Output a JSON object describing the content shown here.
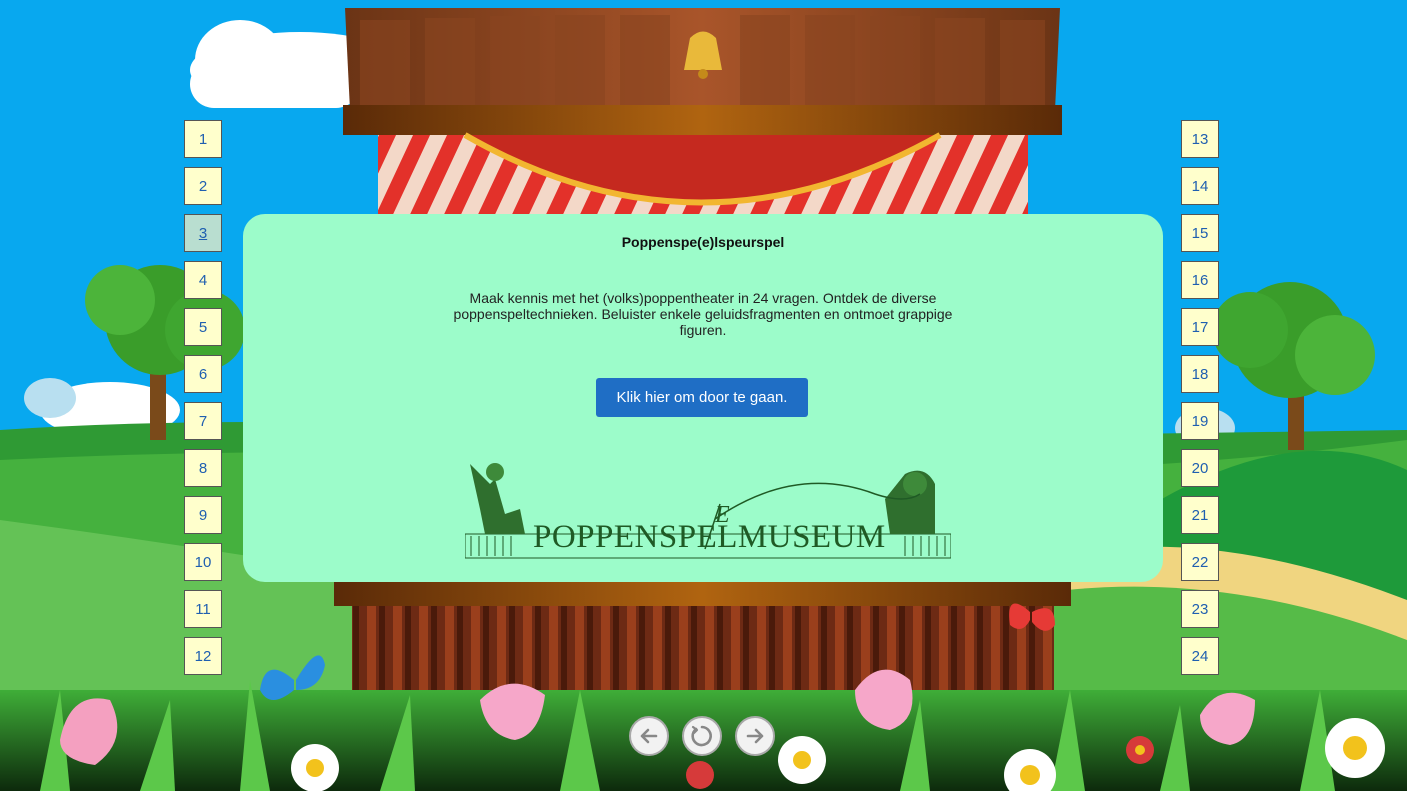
{
  "panel": {
    "title": "Poppenspe(e)lspeurspel",
    "intro": "Maak kennis met het (volks)poppentheater in 24 vragen. Ontdek de diverse poppenspeltechnieken. Beluister enkele geluidsfragmenten en ontmoet grappige figuren.",
    "continue_label": "Klik hier om door te gaan.",
    "logo_text": "POPPENSPELMUSEUM",
    "logo_e": "E"
  },
  "questions_left": [
    "1",
    "2",
    "3",
    "4",
    "5",
    "6",
    "7",
    "8",
    "9",
    "10",
    "11",
    "12"
  ],
  "questions_right": [
    "13",
    "14",
    "15",
    "16",
    "17",
    "18",
    "19",
    "20",
    "21",
    "22",
    "23",
    "24"
  ],
  "active_question": "3",
  "nav": {
    "prev_icon": "arrow-left-icon",
    "reload_icon": "reload-icon",
    "next_icon": "arrow-right-icon"
  },
  "colors": {
    "sky": "#08a8ef",
    "panel": "#9cfcca",
    "button": "#1f6ec5",
    "question_bg": "#ffffcc",
    "question_text": "#1f5fb0"
  }
}
